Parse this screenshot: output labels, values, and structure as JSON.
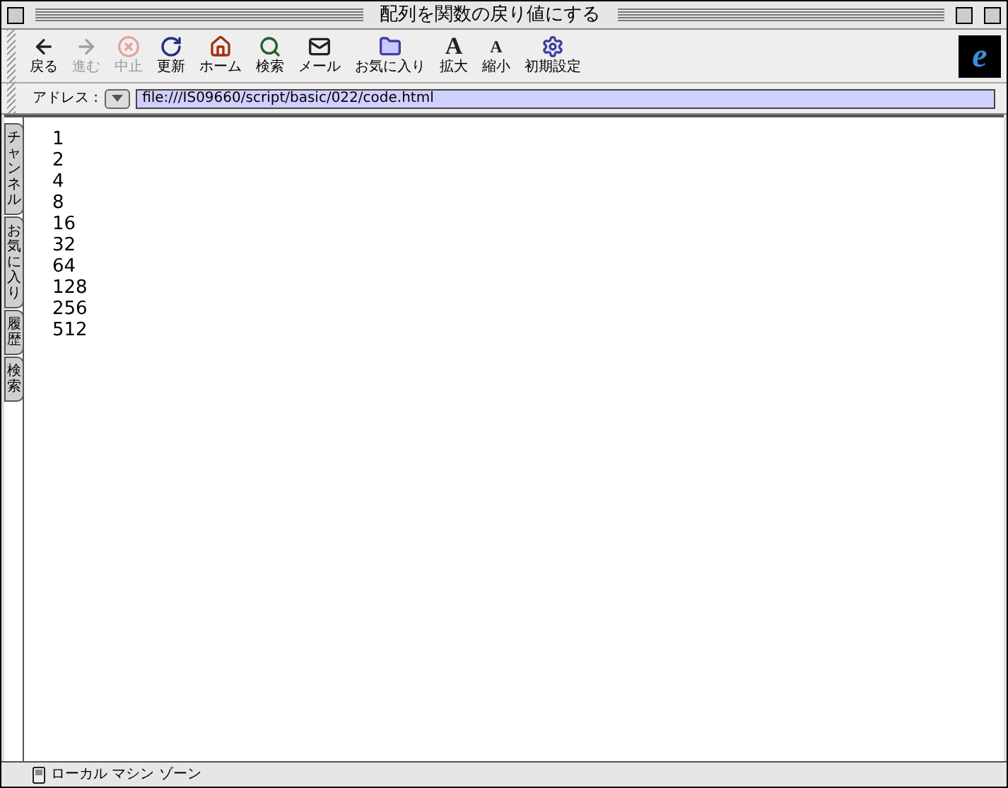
{
  "window": {
    "title": "配列を関数の戻り値にする"
  },
  "toolbar": [
    {
      "kind": "back",
      "label": "戻る",
      "disabled": false
    },
    {
      "kind": "forward",
      "label": "進む",
      "disabled": true
    },
    {
      "kind": "stop",
      "label": "中止",
      "disabled": true
    },
    {
      "kind": "refresh",
      "label": "更新",
      "disabled": false
    },
    {
      "kind": "home",
      "label": "ホーム",
      "disabled": false
    },
    {
      "kind": "search",
      "label": "検索",
      "disabled": false
    },
    {
      "kind": "mail",
      "label": "メール",
      "disabled": false
    },
    {
      "kind": "favorites",
      "label": "お気に入り",
      "disabled": false
    },
    {
      "kind": "larger",
      "label": "拡大",
      "glyph": "A",
      "disabled": false
    },
    {
      "kind": "smaller",
      "label": "縮小",
      "glyph": "A",
      "disabled": false
    },
    {
      "kind": "settings",
      "label": "初期設定",
      "disabled": false
    }
  ],
  "logo": {
    "glyph": "e"
  },
  "address_bar": {
    "label": "アドレス :",
    "value": "file:///IS09660/script/basic/022/code.html"
  },
  "side_tabs": [
    "チャンネル",
    "お気に入り",
    "履歴",
    "検索"
  ],
  "content_lines": [
    "1",
    "2",
    "4",
    "8",
    "16",
    "32",
    "64",
    "128",
    "256",
    "512"
  ],
  "status_bar": {
    "text": "ローカル マシン ゾーン"
  }
}
